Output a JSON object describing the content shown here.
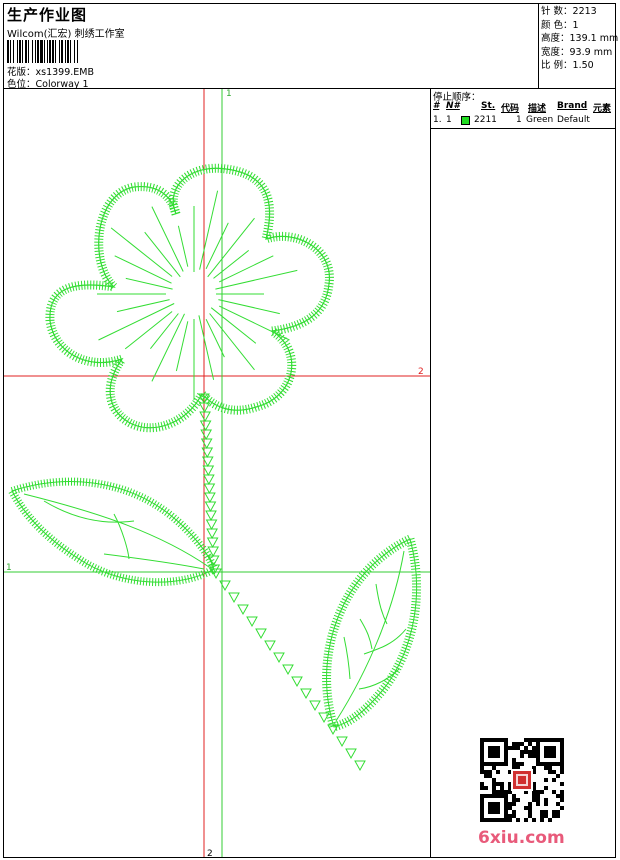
{
  "header": {
    "title": "生产作业图",
    "company": "Wilcom(汇宏) 刺绣工作室",
    "design_label": "花版：",
    "design_value": "xs1399.EMB",
    "colorway_label": "色位：",
    "colorway_value": "Colorway 1"
  },
  "stats": [
    {
      "label": "针 数：",
      "value": "2213"
    },
    {
      "label": "颜 色：",
      "value": "1"
    },
    {
      "label": "高度：",
      "value": "139.1 mm"
    },
    {
      "label": "宽度：",
      "value": "93.9 mm"
    },
    {
      "label": "比 例：",
      "value": "1.50"
    }
  ],
  "stop_sequence": {
    "label": "停止顺序：",
    "columns": [
      "#",
      "N#",
      "St.",
      "代码",
      "描述",
      "Brand",
      "元素"
    ],
    "rows": [
      {
        "index": "1.",
        "needle": "1",
        "swatch_color": "#22dd22",
        "stitches": "2211",
        "code": "1",
        "description": "Green",
        "brand": "Default",
        "element": ""
      }
    ]
  },
  "guides": {
    "vertical_1": "1",
    "vertical_2": "2",
    "horizontal_1": "1",
    "horizontal_2": "2"
  },
  "colors": {
    "thread": "#33dd33",
    "guide_red": "#e02020",
    "guide_green": "#33cc33",
    "watermark": "#e85a7a"
  },
  "watermark": {
    "text_a": "6xiu",
    "text_b": ".com"
  },
  "icons": {
    "qr": "qr-code-icon",
    "seal": "red-seal-icon"
  }
}
